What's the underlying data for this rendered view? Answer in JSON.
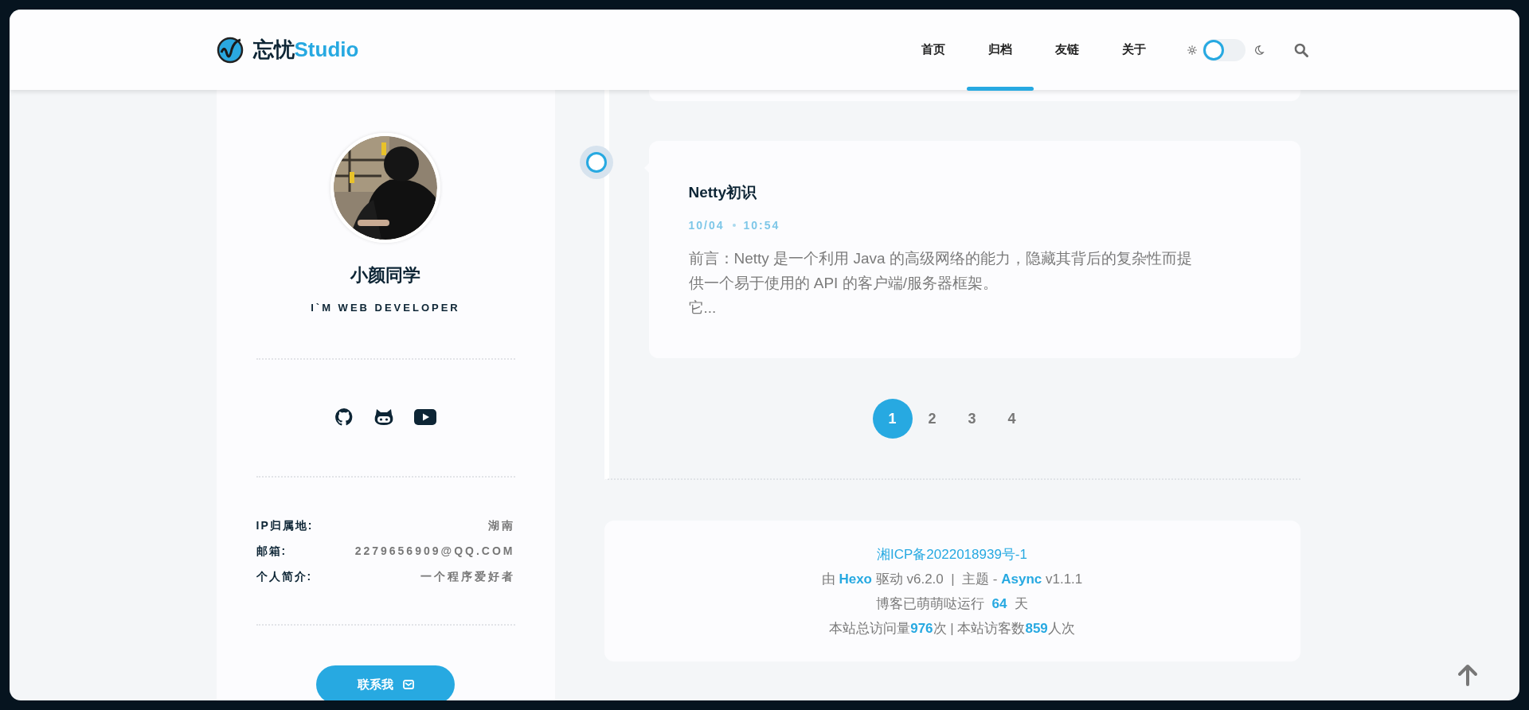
{
  "header": {
    "logo": {
      "name": "忘忧",
      "accent": "Studio"
    },
    "nav": [
      {
        "label": "首页",
        "selected": false
      },
      {
        "label": "归档",
        "selected": true
      },
      {
        "label": "友链",
        "selected": false
      },
      {
        "label": "关于",
        "selected": false
      }
    ],
    "dark_mode": {
      "on": false
    }
  },
  "profile": {
    "name": "小颜同学",
    "tagline": "I`M WEB DEVELOPER",
    "info": [
      {
        "label": "IP归属地:",
        "value": "湖南"
      },
      {
        "label": "邮箱:",
        "value": "2279656909@QQ.COM"
      },
      {
        "label": "个人简介:",
        "value": "一个程序爱好者"
      }
    ],
    "contact_button": "联系我"
  },
  "posts": [
    {
      "title": "Netty初识",
      "date": "10/04",
      "time": "10:54",
      "excerpt": [
        "前言：Netty 是一个利用 Java 的高级网络的能力，隐藏其背后的复杂性而提",
        "供一个易于使用的 API 的客户端/服务器框架。",
        "它..."
      ]
    }
  ],
  "pagination": {
    "pages": [
      {
        "label": "1",
        "selected": true
      },
      {
        "label": "2",
        "selected": false
      },
      {
        "label": "3",
        "selected": false
      },
      {
        "label": "4",
        "selected": false
      }
    ]
  },
  "footer": {
    "icp": "湘ICP备2022018939号-1",
    "lines": [
      [
        {
          "kind": "text",
          "text": "由 "
        },
        {
          "kind": "link",
          "text": "Hexo"
        },
        {
          "kind": "text",
          "text": " 驱动 v6.2.0  |  主题 - "
        },
        {
          "kind": "link",
          "text": "Async"
        },
        {
          "kind": "text",
          "text": " v1.1.1"
        }
      ],
      [
        {
          "kind": "text",
          "text": "博客已萌萌哒运行  "
        },
        {
          "kind": "value",
          "text": "64"
        },
        {
          "kind": "text",
          "text": "  天"
        }
      ],
      [
        {
          "kind": "text",
          "text": "本站总访问量"
        },
        {
          "kind": "value",
          "text": "976"
        },
        {
          "kind": "text",
          "text": "次 | 本站访客数"
        },
        {
          "kind": "value",
          "text": "859"
        },
        {
          "kind": "text",
          "text": "人次"
        }
      ]
    ]
  }
}
